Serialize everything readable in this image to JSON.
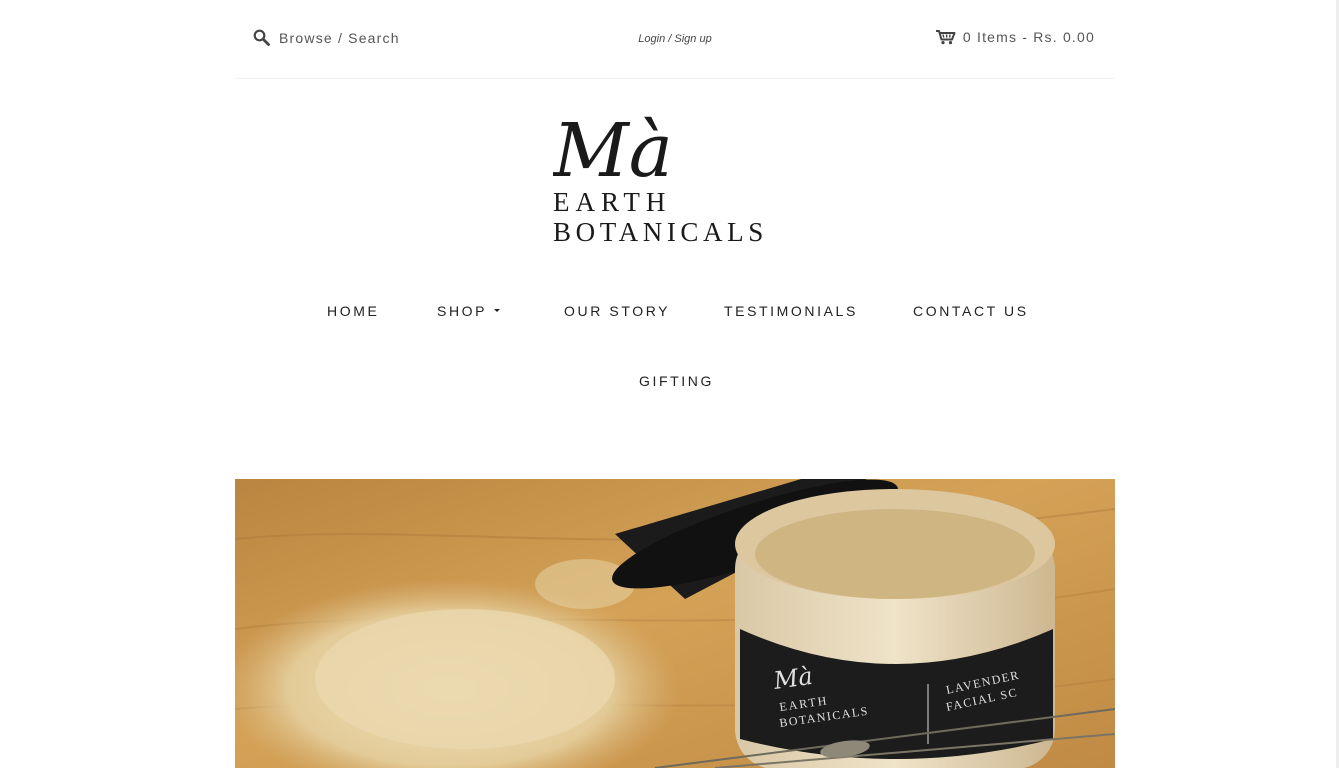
{
  "header": {
    "search_label": "Browse / Search",
    "login_label": "Login / Sign up",
    "cart_label": "0 Items - Rs. 0.00"
  },
  "logo": {
    "script_text": "Mà",
    "line1": "EARTH",
    "line2": "BOTANICALS"
  },
  "nav": {
    "items": [
      {
        "label": "HOME"
      },
      {
        "label": "SHOP"
      },
      {
        "label": "OUR STORY"
      },
      {
        "label": "TESTIMONIALS"
      },
      {
        "label": "CONTACT US"
      },
      {
        "label": "GIFTING"
      }
    ]
  },
  "hero": {
    "jar_brand_script": "Mà",
    "jar_brand_line1": "EARTH",
    "jar_brand_line2": "BOTANICALS",
    "jar_product_line1": "LAVENDER",
    "jar_product_line2": "FACIAL SC"
  },
  "colors": {
    "text_dark": "#222222",
    "text_muted": "#555555",
    "wood": "#c99a4e",
    "powder": "#e8d3a5",
    "jar_lid": "#1b1b1b"
  },
  "icons": [
    "search-icon",
    "cart-icon",
    "caret-down-icon"
  ]
}
